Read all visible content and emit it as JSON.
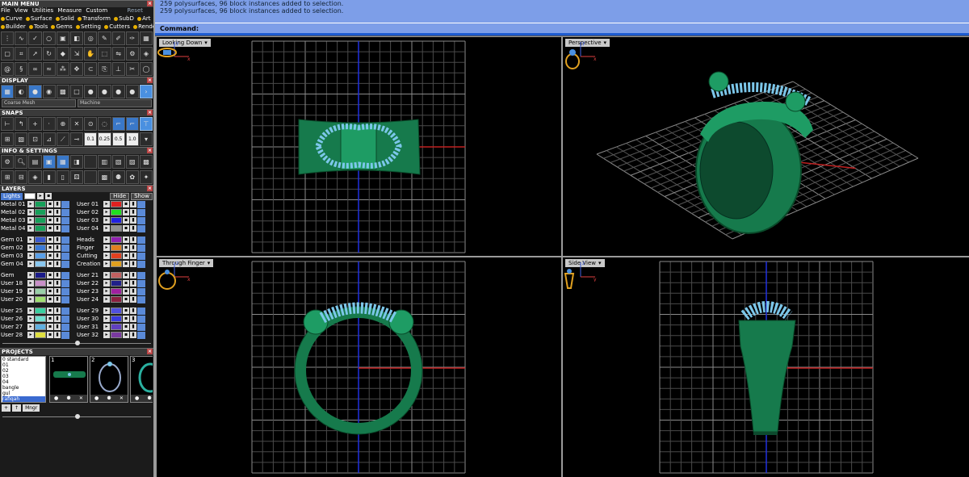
{
  "main_menu": {
    "title": "MAIN MENU",
    "menubar": [
      "File",
      "View",
      "Utilities",
      "Measure",
      "Custom"
    ],
    "reset_label": "Reset",
    "tabs_row1": [
      "Curve",
      "Surface",
      "Solid",
      "Transform",
      "SubD",
      "Art"
    ],
    "tabs_row2": [
      "Builder",
      "Tools",
      "Gems",
      "Setting",
      "Cutters",
      "Render"
    ]
  },
  "display": {
    "title": "DISPLAY",
    "mesh_select": "Coarse Mesh",
    "material_select": "Machine"
  },
  "snaps": {
    "title": "SNAPS",
    "values": [
      "0.1",
      "0.25",
      "0.5",
      "1.0"
    ]
  },
  "info": {
    "title": "INFO & SETTINGS"
  },
  "layers": {
    "title": "LAYERS",
    "lights_label": "Lights",
    "hide_label": "Hide",
    "show_label": "Show",
    "left": [
      {
        "name": "Metal 01",
        "color": "#16a05a"
      },
      {
        "name": "Metal 02",
        "color": "#16a05a"
      },
      {
        "name": "Metal 03",
        "color": "#16a05a"
      },
      {
        "name": "Metal 04",
        "color": "#16a05a"
      },
      {
        "name": "Gem 01",
        "color": "#3a5ad0"
      },
      {
        "name": "Gem 02",
        "color": "#3a7ad8"
      },
      {
        "name": "Gem 03",
        "color": "#5aa0e8"
      },
      {
        "name": "Gem 04",
        "color": "#8ac8f0"
      },
      {
        "name": "Gem",
        "color": "#1a1a8a"
      },
      {
        "name": "User 18",
        "color": "#c890c8"
      },
      {
        "name": "User 19",
        "color": "#9ad0a8"
      },
      {
        "name": "User 20",
        "color": "#a0e070"
      },
      {
        "name": "User 25",
        "color": "#3ad0a0"
      },
      {
        "name": "User 26",
        "color": "#70e0d0"
      },
      {
        "name": "User 27",
        "color": "#60b0e0"
      },
      {
        "name": "User 28",
        "color": "#e0e040"
      }
    ],
    "right": [
      {
        "name": "User 01",
        "color": "#e02020"
      },
      {
        "name": "User 02",
        "color": "#20e020"
      },
      {
        "name": "User 03",
        "color": "#2020e0"
      },
      {
        "name": "User 04",
        "color": "#909090"
      },
      {
        "name": "Heads",
        "color": "#9020b0"
      },
      {
        "name": "Finger",
        "color": "#e08020"
      },
      {
        "name": "Cutting",
        "color": "#e04020"
      },
      {
        "name": "Creation",
        "color": "#e0a020"
      },
      {
        "name": "User 21",
        "color": "#c06060"
      },
      {
        "name": "User 22",
        "color": "#20208a"
      },
      {
        "name": "User 23",
        "color": "#a020a0"
      },
      {
        "name": "User 24",
        "color": "#8a2040"
      },
      {
        "name": "User 29",
        "color": "#5050e0"
      },
      {
        "name": "User 30",
        "color": "#3a3ae0"
      },
      {
        "name": "User 31",
        "color": "#6040c0"
      },
      {
        "name": "User 32",
        "color": "#7a3aa0"
      }
    ]
  },
  "projects": {
    "title": "PROJECTS",
    "list": [
      "0 standard",
      "01",
      "02",
      "03",
      "04",
      "bangle",
      "gul",
      "rafiqah"
    ],
    "thumbs": [
      "1",
      "2",
      "3"
    ],
    "buttons": [
      "+",
      "↑",
      "Mngr"
    ]
  },
  "command_area": {
    "history": [
      "259 polysurfaces, 96 block instances added to selection.",
      "259 polysurfaces, 96 block instances added to selection."
    ],
    "prompt": "Command:"
  },
  "viewports": {
    "top_left": {
      "label": "Looking Down",
      "axis_a": "x",
      "axis_b": "y"
    },
    "top_right": {
      "label": "Perspective",
      "axis_a": "x",
      "axis_b": "y"
    },
    "bottom_left": {
      "label": "Through Finger",
      "axis_a": "x",
      "axis_b": "z"
    },
    "bottom_right": {
      "label": "Side View",
      "axis_a": "y",
      "axis_b": "z"
    }
  },
  "colors": {
    "metal": "#167a4c",
    "gem": "#7cc7ea",
    "grid": "#6a6a6a",
    "command_bg": "#7d9ee8"
  }
}
